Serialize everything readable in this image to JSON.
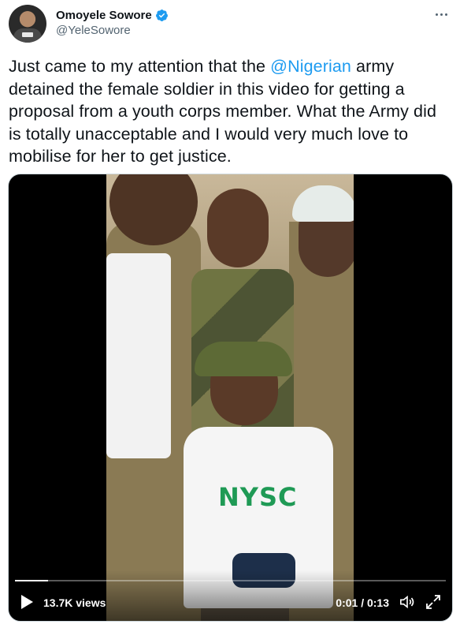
{
  "author": {
    "display_name": "Omoyele Sowore",
    "handle": "@YeleSowore",
    "verified": true
  },
  "tweet": {
    "text_before": "Just came to my attention that the ",
    "mention": "@Nigerian",
    "text_after": " army detained the female soldier in this video for getting a proposal from a youth corps member. What the Army did is totally unacceptable and I would very much love to mobilise for her to get justice."
  },
  "video": {
    "views": "13.7K views",
    "time": "0:01 / 0:13",
    "progress_fraction": 0.077,
    "shirt_text": "NYSC"
  },
  "colors": {
    "accent": "#1d9bf0",
    "text": "#0f1419",
    "secondary": "#536471"
  },
  "icons": [
    "more-icon",
    "verified-badge-icon",
    "play-icon",
    "volume-icon",
    "fullscreen-icon"
  ]
}
